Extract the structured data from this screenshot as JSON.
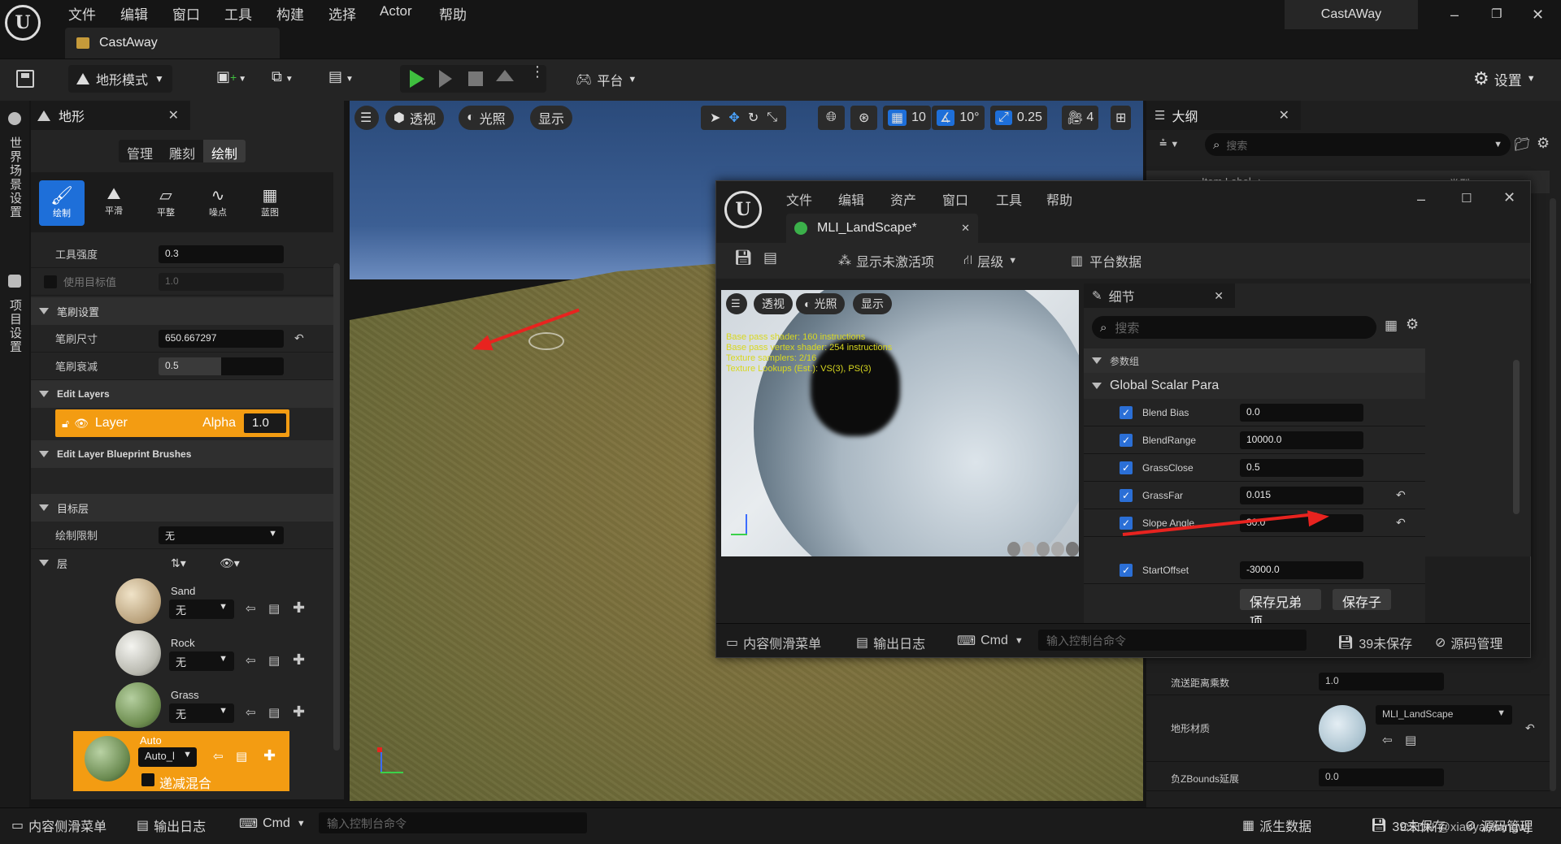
{
  "main_window": {
    "title": "CastAWay",
    "tab_title": "CastAway",
    "menu": [
      "文件",
      "编辑",
      "窗口",
      "工具",
      "构建",
      "选择",
      "Actor",
      "帮助"
    ],
    "window_controls": [
      "–",
      "❐",
      "✕"
    ]
  },
  "toolbar": {
    "mode_label": "地形模式",
    "platform_label": "平台",
    "settings_label": "设置"
  },
  "left_strip": {
    "world_settings": "世界场景设置",
    "project_settings": "项目设置"
  },
  "terrain_panel": {
    "title": "地形",
    "tabs": [
      "管理",
      "雕刻",
      "绘制"
    ],
    "active_tab": "绘制",
    "tools": [
      "绘制",
      "平滑",
      "平整",
      "噪点",
      "蓝图"
    ],
    "tool_strength_label": "工具强度",
    "tool_strength_value": "0.3",
    "use_target_label": "使用目标值",
    "use_target_value": "1.0",
    "brush_section": "笔刷设置",
    "brush_size_label": "笔刷尺寸",
    "brush_size_value": "650.667297",
    "brush_falloff_label": "笔刷衰减",
    "brush_falloff_value": "0.5",
    "edit_layers_section": "Edit Layers",
    "edit_layer_name": "Layer",
    "edit_layer_alpha_label": "Alpha",
    "edit_layer_alpha_value": "1.0",
    "edit_layer_bp_section": "Edit Layer Blueprint Brushes",
    "target_layers_section": "目标层",
    "paint_restriction_label": "绘制限制",
    "paint_restriction_value": "无",
    "layers_label": "层",
    "layers": [
      {
        "name": "Sand",
        "select": "无"
      },
      {
        "name": "Rock",
        "select": "无"
      },
      {
        "name": "Grass",
        "select": "无"
      },
      {
        "name": "Auto",
        "select": "Auto_l"
      }
    ],
    "blend_label": "递减混合"
  },
  "viewport": {
    "perspective": "透视",
    "lit": "光照",
    "show": "显示",
    "grid_value": "10",
    "angle_value": "10°",
    "scale_value": "0.25",
    "camera_speed": "4"
  },
  "outliner": {
    "title": "大纲",
    "search_placeholder": "搜索",
    "item_label_col": "Item Label ▲",
    "type_col": "类型",
    "stream_distance_label": "流送距离乘数",
    "stream_distance_value": "1.0",
    "landscape_material_label": "地形材质",
    "landscape_material_value": "MLI_LandScape",
    "neg_z_bounds_label": "负ZBounds延展",
    "neg_z_bounds_value": "0.0"
  },
  "material_editor": {
    "menu": [
      "文件",
      "编辑",
      "资产",
      "窗口",
      "工具",
      "帮助"
    ],
    "tab_title": "MLI_LandScape*",
    "show_inactive": "显示未激活项",
    "hierarchy": "层级",
    "platform_data": "平台数据",
    "viewport_buttons": [
      "透视",
      "光照",
      "显示"
    ],
    "stats": [
      "Base pass shader: 160 instructions",
      "Base pass vertex shader: 254 instructions",
      "Texture samplers: 2/16",
      "Texture Lookups (Est.): VS(3), PS(3)"
    ],
    "details_title": "细节",
    "details_search_placeholder": "搜索",
    "param_group_label": "参数组",
    "group_name": "Global Scalar Para",
    "params": [
      {
        "name": "Blend Bias",
        "value": "0.0"
      },
      {
        "name": "BlendRange",
        "value": "10000.0"
      },
      {
        "name": "GrassClose",
        "value": "0.5"
      },
      {
        "name": "GrassFar",
        "value": "0.015"
      },
      {
        "name": "Slope Angle",
        "value": "30.0"
      },
      {
        "name": "StartOffset",
        "value": "-3000.0"
      }
    ],
    "save_siblings": "保存兄弟项",
    "save_children": "保存子",
    "content_drawer": "内容侧滑菜单",
    "output_log": "输出日志",
    "cmd": "Cmd",
    "console_placeholder": "输入控制台命令",
    "unsaved": "39未保存",
    "source_control": "源码管理"
  },
  "status_bar": {
    "content_drawer": "内容侧滑菜单",
    "output_log": "输出日志",
    "cmd": "Cmd",
    "console_placeholder": "输入控制台命令",
    "derived_data": "派生数据",
    "unsaved": "39未保存",
    "source_control": "源码管理",
    "watermark": "CSDN @xiaoyaoliangwj"
  },
  "colors": {
    "accent_orange": "#f39c12",
    "accent_blue": "#1e6fd9",
    "play_green": "#3fbf3f",
    "arrow_red": "#e8231f"
  }
}
